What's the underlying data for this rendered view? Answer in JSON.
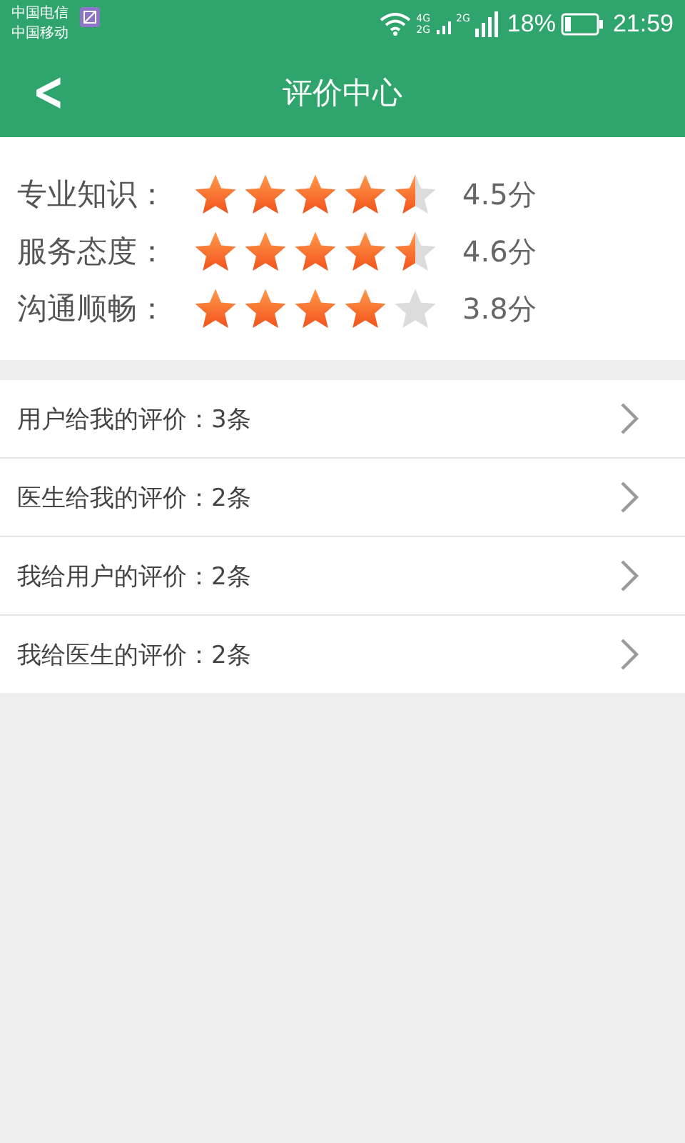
{
  "status_bar": {
    "carriers": [
      "中国电信",
      "中国移动"
    ],
    "network_labels": [
      "4G",
      "2G",
      "2G"
    ],
    "battery": "18%",
    "time": "21:59"
  },
  "header": {
    "back": "<",
    "title": "评价中心"
  },
  "ratings": [
    {
      "label": "专业知识：",
      "stars": 4.5,
      "score": "4.5分"
    },
    {
      "label": "服务态度：",
      "stars": 4.5,
      "score": "4.6分"
    },
    {
      "label": "沟通顺畅：",
      "stars": 4,
      "score": "3.8分"
    }
  ],
  "menu": [
    {
      "label": "用户给我的评价：3条"
    },
    {
      "label": "医生给我的评价：2条"
    },
    {
      "label": "我给用户的评价：2条"
    },
    {
      "label": "我给医生的评价：2条"
    }
  ]
}
